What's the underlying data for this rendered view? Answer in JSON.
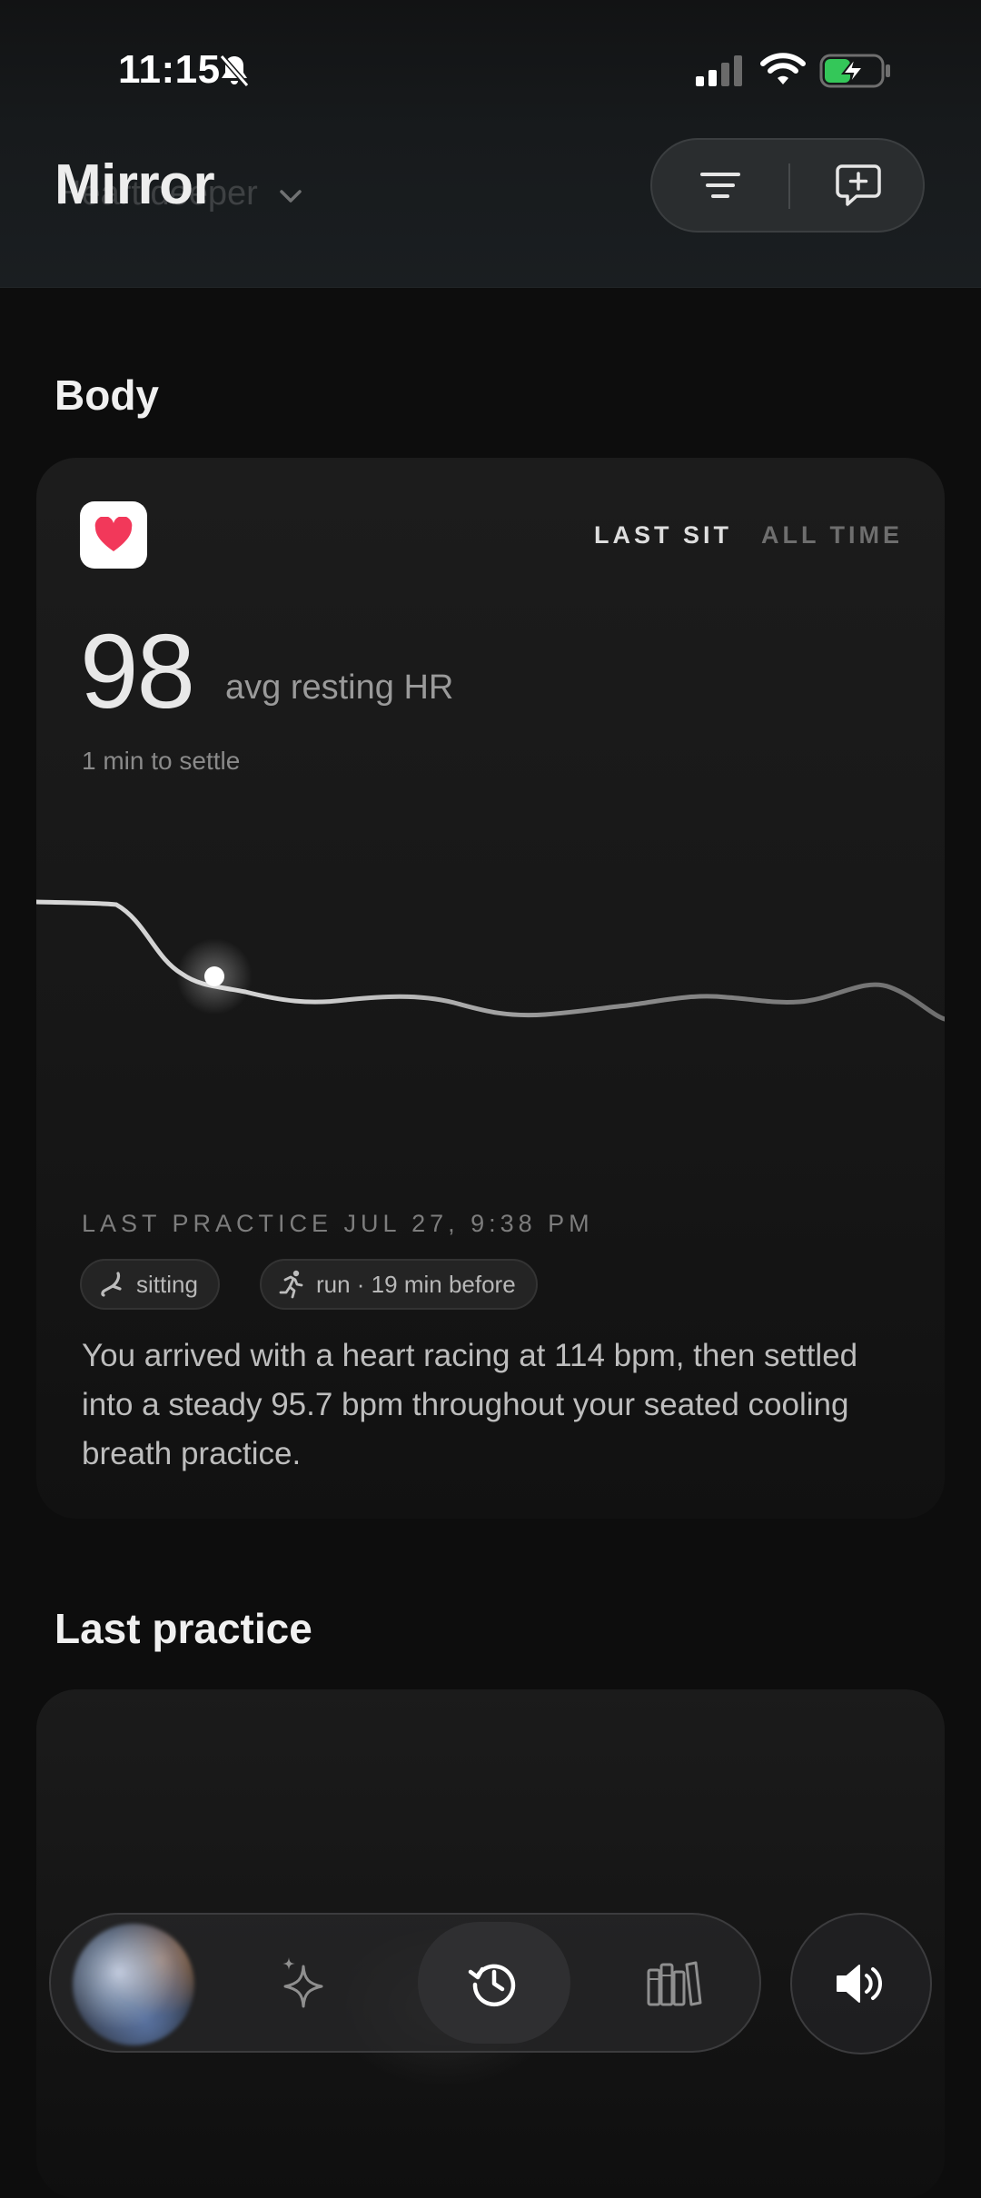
{
  "status_bar": {
    "time": "11:15",
    "icons": [
      "bell-off-icon",
      "signal-icon",
      "wifi-icon",
      "battery-charging-icon"
    ],
    "battery_color": "#34c759"
  },
  "header": {
    "title": "Mirror",
    "ghost_subtitle": "Heart deeper",
    "actions": [
      "filter-icon",
      "new-chat-icon"
    ]
  },
  "body_section": {
    "title": "Body",
    "card": {
      "icon": "heart-icon",
      "heart_color": "#f2385a",
      "tabs": [
        {
          "label": "LAST SIT",
          "active": true
        },
        {
          "label": "ALL TIME",
          "active": false
        }
      ],
      "hr_value": "98",
      "hr_label": "avg resting HR",
      "settle_text": "1 min to settle",
      "practice_heading": "LAST PRACTICE JUL 27, 9:38 PM",
      "chips": [
        {
          "icon": "sitting-icon",
          "label": "sitting"
        },
        {
          "icon": "run-icon",
          "label": "run · 19 min before"
        }
      ],
      "description": "You arrived with a heart racing at 114 bpm, then settled into a steady 95.7 bpm throughout your seated cooling breath practice."
    }
  },
  "last_practice_section": {
    "title": "Last practice"
  },
  "tab_bar": {
    "items": [
      {
        "name": "avatar-orb",
        "active": false
      },
      {
        "name": "sparkles-icon",
        "active": false
      },
      {
        "name": "history-icon",
        "active": true
      },
      {
        "name": "library-icon",
        "active": false
      }
    ],
    "sound_button": "speaker-icon"
  }
}
